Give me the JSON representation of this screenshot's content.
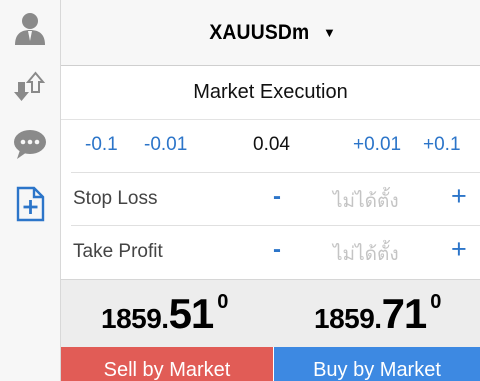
{
  "sidebar": {
    "items": [
      {
        "icon": "user-icon"
      },
      {
        "icon": "transfer-icon"
      },
      {
        "icon": "chat-icon"
      },
      {
        "icon": "new-order-icon"
      }
    ]
  },
  "header": {
    "symbol": "XAUUSDm",
    "caret": "▼"
  },
  "execution": {
    "label": "Market Execution"
  },
  "volume": {
    "dec_large": "-0.1",
    "dec_small": "-0.01",
    "value": "0.04",
    "inc_small": "+0.01",
    "inc_large": "+0.1"
  },
  "stop_loss": {
    "label": "Stop Loss",
    "minus": "-",
    "placeholder": "ไม่ได้ตั้ง",
    "plus": "+"
  },
  "take_profit": {
    "label": "Take Profit",
    "minus": "-",
    "placeholder": "ไม่ได้ตั้ง",
    "plus": "+"
  },
  "quotes": {
    "bid": {
      "main": "1859.",
      "big": "51",
      "sup": "0"
    },
    "ask": {
      "main": "1859.",
      "big": "71",
      "sup": "0"
    }
  },
  "actions": {
    "sell_label": "Sell by Market",
    "buy_label": "Buy by Market"
  },
  "colors": {
    "accent": "#2c75c9",
    "sell": "#e15c56",
    "buy": "#3d89e2",
    "icon_gray": "#8a8a8a"
  }
}
